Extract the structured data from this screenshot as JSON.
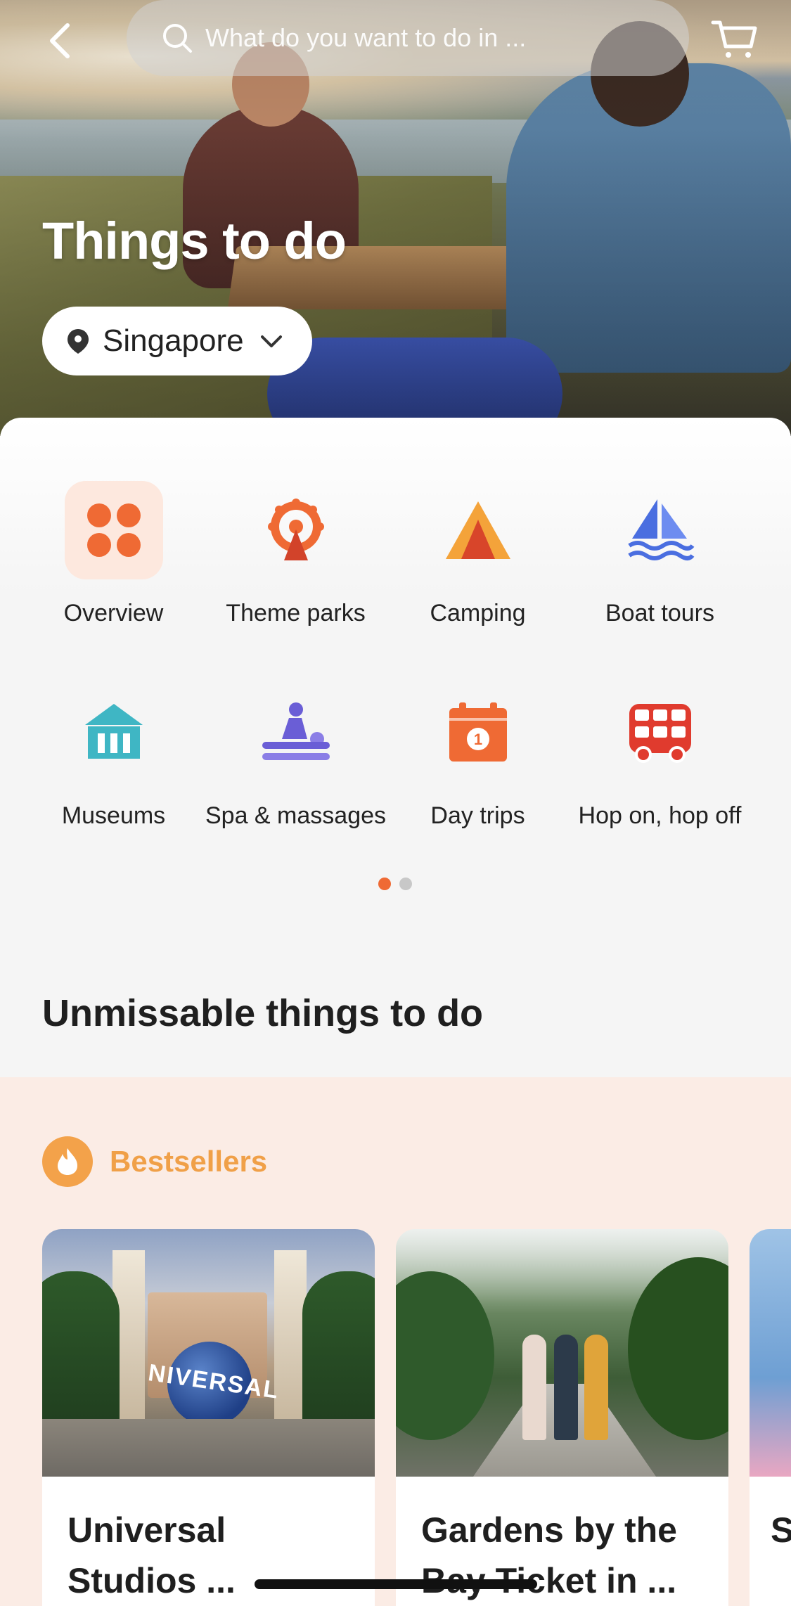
{
  "header": {
    "search_placeholder": "What do you want to do in ...",
    "title": "Things to do",
    "location": "Singapore"
  },
  "categories": [
    {
      "label": "Overview",
      "icon": "overview-icon",
      "active": true
    },
    {
      "label": "Theme parks",
      "icon": "ferris-wheel-icon"
    },
    {
      "label": "Camping",
      "icon": "tent-icon"
    },
    {
      "label": "Boat tours",
      "icon": "sailboat-icon"
    },
    {
      "label": "Museums",
      "icon": "museum-icon"
    },
    {
      "label": "Spa & massages",
      "icon": "spa-icon"
    },
    {
      "label": "Day trips",
      "icon": "calendar-icon"
    },
    {
      "label": "Hop on, hop off",
      "icon": "bus-icon"
    }
  ],
  "pagination": {
    "pages": 2,
    "current": 1
  },
  "section": {
    "title": "Unmissable things to do"
  },
  "bestsellers": {
    "label": "Bestsellers",
    "cards": [
      {
        "title": "Universal Studios ..."
      },
      {
        "title": "Gardens by the Bay Ticket in ..."
      }
    ],
    "peek_text": "S T"
  },
  "colors": {
    "accent": "#ef6a34",
    "bestseller": "#f0a048",
    "bestseller_bg": "#fbece5"
  }
}
